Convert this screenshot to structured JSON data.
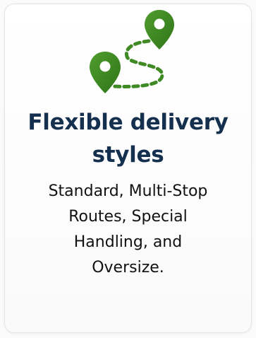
{
  "card": {
    "illustration_icon": "map-route-with-location-pins-icon",
    "accent_color": "#3f8a25",
    "title_color": "#15304e",
    "title_lines": [
      "Flexible delivery",
      "styles"
    ],
    "description_lines": [
      "Standard, Multi-Stop",
      "Routes, Special",
      "Handling, and",
      "Oversize."
    ]
  }
}
